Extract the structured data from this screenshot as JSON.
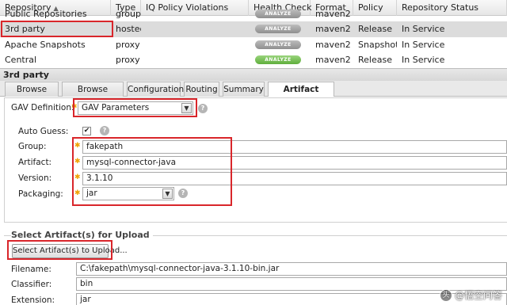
{
  "table": {
    "headers": [
      "Repository",
      "Type",
      "IQ Policy Violations",
      "Health Check",
      "Format",
      "Policy",
      "Repository Status"
    ],
    "sort_indicator": "▲",
    "rows": [
      {
        "repository": "Public Repositories",
        "type": "group",
        "health": "ANALYZE",
        "format": "maven2",
        "policy": "",
        "status": ""
      },
      {
        "repository": "3rd party",
        "type": "hosted",
        "health": "ANALYZE",
        "format": "maven2",
        "policy": "Release",
        "status": "In Service"
      },
      {
        "repository": "Apache Snapshots",
        "type": "proxy",
        "health": "ANALYZE",
        "format": "maven2",
        "policy": "Snapshot",
        "status": "In Service"
      },
      {
        "repository": "Central",
        "type": "proxy",
        "health": "ANALYZE",
        "format": "maven2",
        "policy": "Release",
        "status": "In Service"
      }
    ]
  },
  "panel": {
    "title": "3rd party",
    "tabs": [
      "Browse Index",
      "Browse Storage",
      "Configuration",
      "Routing",
      "Summary",
      "Artifact Upload"
    ],
    "active_tab": "Artifact Upload"
  },
  "form": {
    "gav_definition_label": "GAV Definition:",
    "gav_definition_value": "GAV Parameters",
    "auto_guess_label": "Auto Guess:",
    "auto_guess_checked": "✔",
    "group_label": "Group:",
    "group_value": "fakepath",
    "artifact_label": "Artifact:",
    "artifact_value": "mysql-connector-java",
    "version_label": "Version:",
    "version_value": "3.1.10",
    "packaging_label": "Packaging:",
    "packaging_value": "jar"
  },
  "upload": {
    "section_title": "Select Artifact(s) for Upload",
    "select_button": "Select Artifact(s) to Upload...",
    "filename_label": "Filename:",
    "filename_value": "C:\\fakepath\\mysql-connector-java-3.1.10-bin.jar",
    "classifier_label": "Classifier:",
    "classifier_value": "bin",
    "extension_label": "Extension:",
    "extension_value": "jar"
  },
  "icons": {
    "required": "✱",
    "help": "?",
    "dropdown": "▼"
  },
  "watermark": {
    "logo": "头",
    "text": "@悟空问答"
  },
  "colors": {
    "highlight_box": "#d9262b",
    "required_star": "#f0a000",
    "analyze_grey": "#9e9e9e",
    "analyze_green": "#6cb84a"
  }
}
